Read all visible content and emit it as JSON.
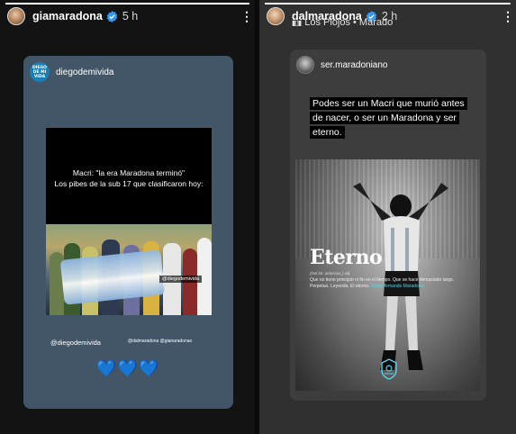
{
  "left_story": {
    "progress": 1.0,
    "username": "giamaradona",
    "time": "5 h",
    "more_label": "⋮",
    "card": {
      "account_logo_text": [
        "DIEGO",
        "DE MI",
        "VIDA"
      ],
      "account": "diegodemivida",
      "post_text_line1": "Macri: \"la era Maradona terminó\"",
      "post_text_line2": "Los pibes de la sub 17  que clasificaron hoy:",
      "photo_handle": "@diegodemivida",
      "mention": "@diegodemivida",
      "tags": "@dalmaradona @gianaradonao",
      "hearts": "💙💙💙"
    }
  },
  "right_story": {
    "progress": 1.0,
    "username": "dalmaradona",
    "time": "2 h",
    "more_label": "⋮",
    "music": "Los Piojos • Marado",
    "card": {
      "account": "ser.maradoniano",
      "quote": "Podes ser un Macri que murió antes de nacer, o ser un Maradona y ser eterno.",
      "poster_title": "Eterno",
      "definition_pron": "(Del lat. aeternus.) adj.",
      "definition_text": "Que no tiene principio ni fin en el tiempo. Que se hace demasiado largo. Perpetuo. Leyenda. El eterno.",
      "definition_name": "Diego Armando Maradona."
    }
  },
  "colors": {
    "verified": "#3897f0",
    "left_card": "#425668",
    "hearts": "#1e88ff",
    "highlight": "#5fd0e6"
  }
}
